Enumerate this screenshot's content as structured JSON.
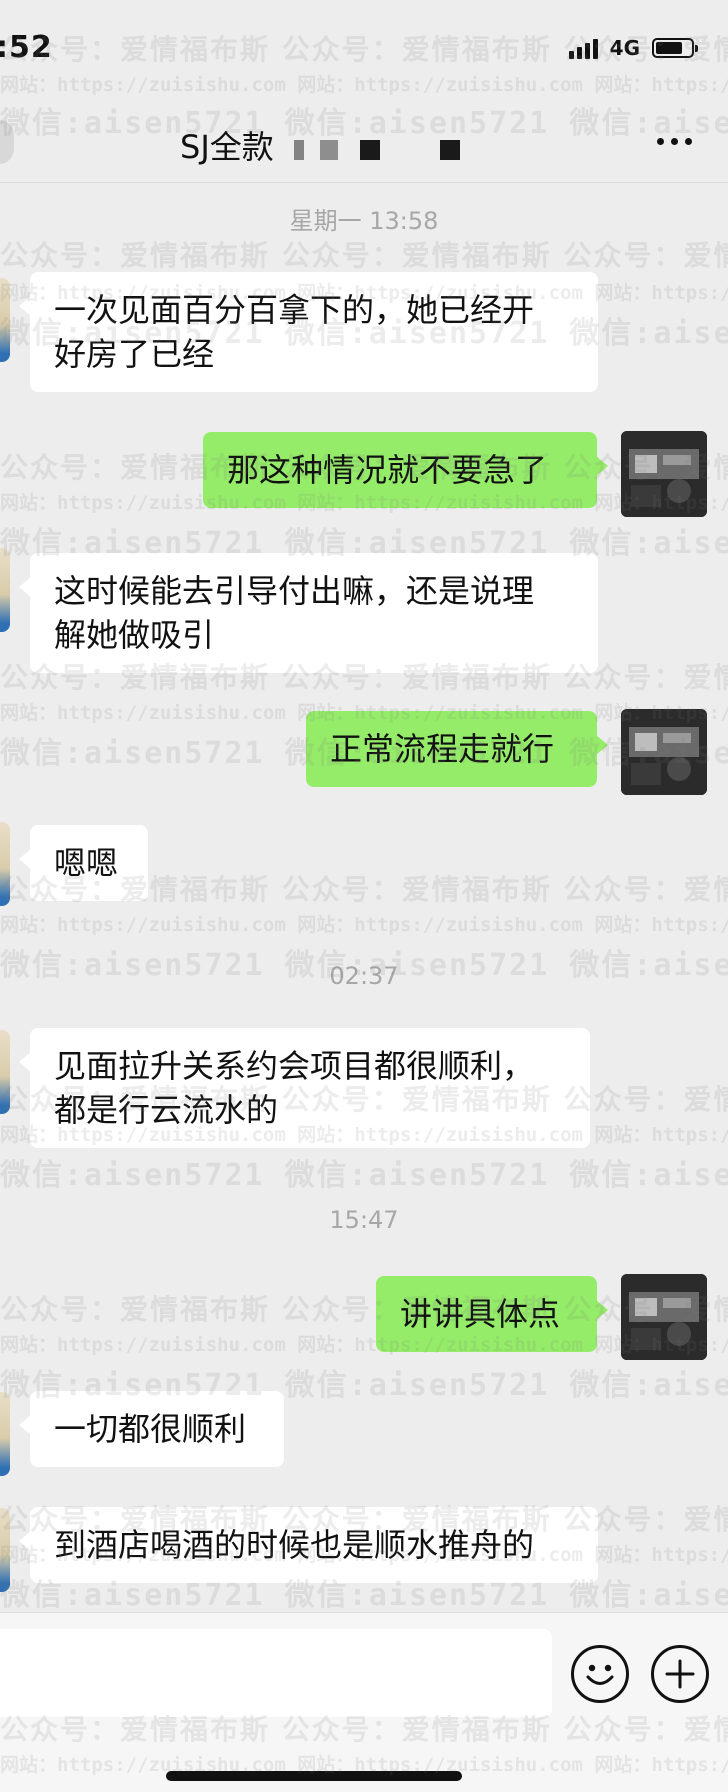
{
  "status_bar": {
    "time": ":52",
    "network": "4G",
    "battery_level": 0.75
  },
  "header": {
    "title": "SJ全款",
    "more_icon": "more-dots-icon"
  },
  "messages": [
    {
      "kind": "timestamp",
      "text": "星期一 13:58"
    },
    {
      "kind": "bubble",
      "side": "in",
      "lines": [
        "一次见面百分百拿下的，她已经开",
        "好房了已经"
      ]
    },
    {
      "kind": "bubble",
      "side": "out",
      "lines": [
        "那这种情况就不要急了"
      ]
    },
    {
      "kind": "bubble",
      "side": "in",
      "lines": [
        "这时候能去引导付出嘛，还是说理",
        "解她做吸引"
      ]
    },
    {
      "kind": "bubble",
      "side": "out",
      "lines": [
        "正常流程走就行"
      ]
    },
    {
      "kind": "bubble",
      "side": "in",
      "lines": [
        "嗯嗯"
      ]
    },
    {
      "kind": "timestamp",
      "text": "02:37"
    },
    {
      "kind": "bubble",
      "side": "in",
      "lines": [
        "见面拉升关系约会项目都很顺利，",
        "都是行云流水的"
      ]
    },
    {
      "kind": "timestamp",
      "text": "15:47"
    },
    {
      "kind": "bubble",
      "side": "out",
      "lines": [
        "讲讲具体点"
      ]
    },
    {
      "kind": "bubble",
      "side": "in",
      "lines": [
        "一切都很顺利"
      ]
    },
    {
      "kind": "bubble",
      "side": "in",
      "lines": [
        "到酒店喝酒的时候也是顺水推舟的"
      ]
    }
  ],
  "input_bar": {
    "value": "",
    "emoji_icon": "emoji-smile-icon",
    "plus_icon": "plus-circle-icon"
  },
  "watermark": {
    "line_a": "公众号：爱情福布斯",
    "line_b": "网站：https://zuisishu.com",
    "line_c": "微信:aisen5721"
  },
  "colors": {
    "background": "#ededed",
    "incoming_bubble": "#ffffff",
    "outgoing_bubble": "#95ec69",
    "timestamp": "#a7a7a7"
  }
}
